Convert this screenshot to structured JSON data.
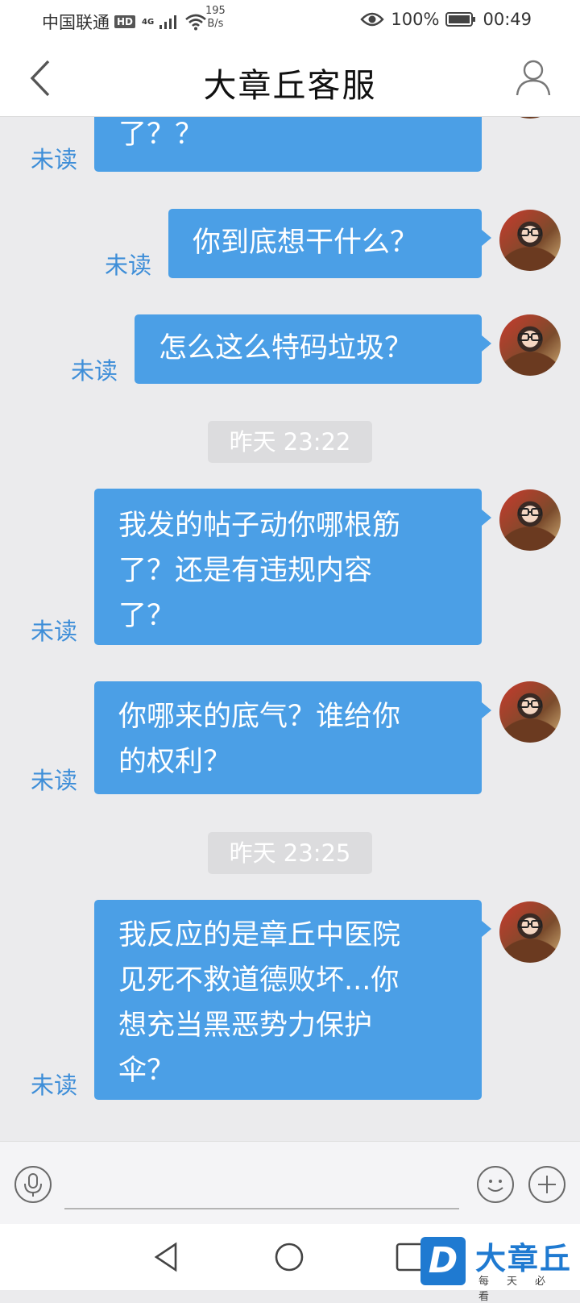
{
  "status_bar": {
    "carrier": "中国联通",
    "hd": "HD",
    "network": "4G",
    "speed_value": "195",
    "speed_unit": "B/s",
    "battery": "100%",
    "time": "00:49"
  },
  "header": {
    "title": "大章丘客服",
    "back_icon": "chevron-left-icon",
    "profile_icon": "person-icon"
  },
  "messages": [
    {
      "type": "text",
      "lines": [
        "了？？"
      ],
      "status": "未读"
    },
    {
      "type": "text",
      "lines": [
        "你到底想干什么？"
      ],
      "status": "未读"
    },
    {
      "type": "text",
      "lines": [
        "怎么这么特码垃圾？"
      ],
      "status": "未读"
    },
    {
      "type": "time",
      "text": "昨天 23:22"
    },
    {
      "type": "text",
      "lines": [
        "我发的帖子动你哪根筋",
        "了？还是有违规内容",
        "了？"
      ],
      "status": "未读"
    },
    {
      "type": "text",
      "lines": [
        "你哪来的底气？谁给你",
        "的权利？"
      ],
      "status": "未读"
    },
    {
      "type": "time",
      "text": "昨天 23:25"
    },
    {
      "type": "text",
      "lines": [
        "我反应的是章丘中医院",
        "见死不救道德败坏...你",
        "想充当黑恶势力保护",
        "伞？"
      ],
      "status": "未读"
    }
  ],
  "input_bar": {
    "voice_icon": "microphone-icon",
    "emoji_icon": "emoji-icon",
    "plus_icon": "plus-icon",
    "text_value": ""
  },
  "watermark": {
    "mark": "D",
    "name": "大章丘",
    "tagline": "每天必看"
  },
  "colors": {
    "bubble": "#4b9fe6",
    "unread": "#3e8ed8",
    "background": "#ebebed"
  }
}
